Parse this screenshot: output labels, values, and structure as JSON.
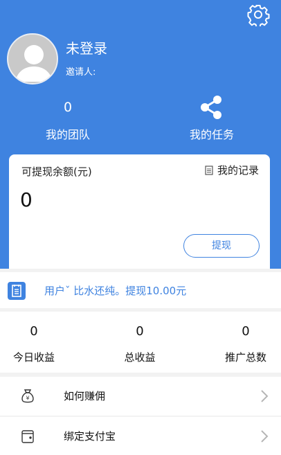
{
  "header": {
    "username": "未登录",
    "inviter_label": "邀请人:",
    "team": {
      "count": "0",
      "label": "我的团队"
    },
    "task": {
      "label": "我的任务"
    }
  },
  "balance": {
    "title": "可提现余额(元)",
    "records_label": "我的记录",
    "value": "0",
    "withdraw_label": "提现"
  },
  "notice": {
    "text": "用户ˇ 比水还纯。提现10.00元"
  },
  "stats": [
    {
      "value": "0",
      "label": "今日收益"
    },
    {
      "value": "0",
      "label": "总收益"
    },
    {
      "value": "0",
      "label": "推广总数"
    }
  ],
  "menu": [
    {
      "label": "如何赚佣",
      "icon": "money-bag-icon"
    },
    {
      "label": "绑定支付宝",
      "icon": "wallet-icon"
    }
  ],
  "colors": {
    "primary": "#3f83e0",
    "background": "#f2f2f2",
    "card": "#ffffff"
  }
}
